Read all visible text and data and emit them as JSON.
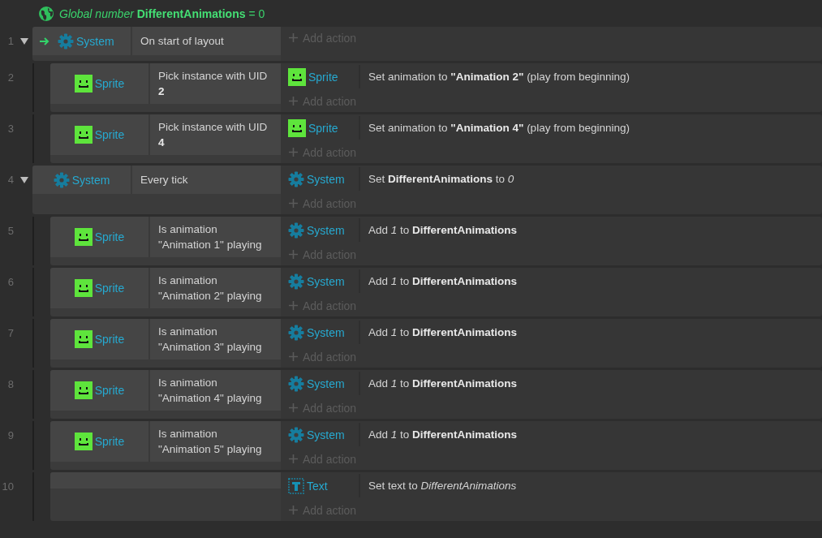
{
  "global_variable": {
    "text": "*Global number* **DifferentAnimations** = 0"
  },
  "events": [
    {
      "number": "1",
      "expanded": true,
      "conditions": [
        {
          "kind": "system",
          "object": "System",
          "text": "On start of layout",
          "trigger": true
        }
      ],
      "add_action": "Add action",
      "children": [
        {
          "number": "2",
          "conditions": [
            {
              "kind": "sprite",
              "object": "Sprite",
              "text": "Pick instance with UID **2**",
              "trigger": false
            }
          ],
          "actions": [
            {
              "kind": "sprite",
              "object": "Sprite",
              "text": "Set animation to **\"Animation 2\"** (play from beginning)"
            }
          ],
          "add_action": "Add action"
        },
        {
          "number": "3",
          "conditions": [
            {
              "kind": "sprite",
              "object": "Sprite",
              "text": "Pick instance with UID **4**",
              "trigger": false
            }
          ],
          "actions": [
            {
              "kind": "sprite",
              "object": "Sprite",
              "text": "Set animation to **\"Animation 4\"** (play from beginning)"
            }
          ],
          "add_action": "Add action"
        }
      ]
    },
    {
      "number": "4",
      "expanded": true,
      "conditions": [
        {
          "kind": "system",
          "object": "System",
          "text": "Every tick",
          "trigger": false
        }
      ],
      "actions": [
        {
          "kind": "system",
          "object": "System",
          "text": "Set **DifferentAnimations** to *0*"
        }
      ],
      "add_action": "Add action",
      "children": [
        {
          "number": "5",
          "conditions": [
            {
              "kind": "sprite",
              "object": "Sprite",
              "text": "Is animation \"Animation 1\" playing",
              "trigger": false
            }
          ],
          "actions": [
            {
              "kind": "system",
              "object": "System",
              "text": "Add *1* to **DifferentAnimations**"
            }
          ],
          "add_action": "Add action"
        },
        {
          "number": "6",
          "conditions": [
            {
              "kind": "sprite",
              "object": "Sprite",
              "text": "Is animation \"Animation 2\" playing",
              "trigger": false
            }
          ],
          "actions": [
            {
              "kind": "system",
              "object": "System",
              "text": "Add *1* to **DifferentAnimations**"
            }
          ],
          "add_action": "Add action"
        },
        {
          "number": "7",
          "conditions": [
            {
              "kind": "sprite",
              "object": "Sprite",
              "text": "Is animation \"Animation 3\" playing",
              "trigger": false
            }
          ],
          "actions": [
            {
              "kind": "system",
              "object": "System",
              "text": "Add *1* to **DifferentAnimations**"
            }
          ],
          "add_action": "Add action"
        },
        {
          "number": "8",
          "conditions": [
            {
              "kind": "sprite",
              "object": "Sprite",
              "text": "Is animation \"Animation 4\" playing",
              "trigger": false
            }
          ],
          "actions": [
            {
              "kind": "system",
              "object": "System",
              "text": "Add *1* to **DifferentAnimations**"
            }
          ],
          "add_action": "Add action"
        },
        {
          "number": "9",
          "conditions": [
            {
              "kind": "sprite",
              "object": "Sprite",
              "text": "Is animation \"Animation 5\" playing",
              "trigger": false
            }
          ],
          "actions": [
            {
              "kind": "system",
              "object": "System",
              "text": "Add *1* to **DifferentAnimations**"
            }
          ],
          "add_action": "Add action"
        },
        {
          "number": "10",
          "actions": [
            {
              "kind": "text",
              "object": "Text",
              "text": "Set text to *DifferentAnimations*"
            }
          ],
          "add_action": "Add action"
        }
      ]
    }
  ]
}
